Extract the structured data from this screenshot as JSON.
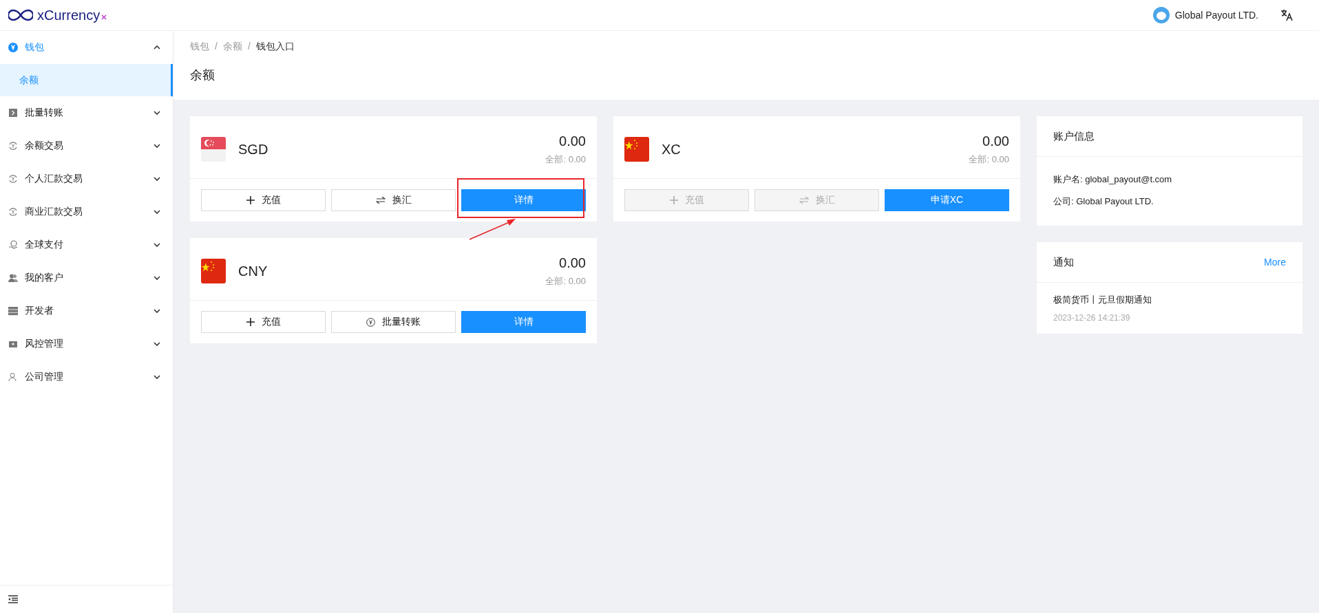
{
  "header": {
    "logo": "xCurrency",
    "account": "Global Payout LTD."
  },
  "sidebar": {
    "items": [
      {
        "label": "钱包",
        "expanded": true,
        "children": [
          {
            "label": "余额",
            "selected": true
          }
        ]
      },
      {
        "label": "批量转账",
        "expanded": false
      },
      {
        "label": "余额交易",
        "expanded": false
      },
      {
        "label": "个人汇款交易",
        "expanded": false
      },
      {
        "label": "商业汇款交易",
        "expanded": false
      },
      {
        "label": "全球支付",
        "expanded": false
      },
      {
        "label": "我的客户",
        "expanded": false
      },
      {
        "label": "开发者",
        "expanded": false
      },
      {
        "label": "风控管理",
        "expanded": false
      },
      {
        "label": "公司管理",
        "expanded": false
      }
    ]
  },
  "breadcrumb": {
    "separator": "/",
    "items": [
      "钱包",
      "余额",
      "钱包入口"
    ]
  },
  "page_title": "余额",
  "wallets": [
    {
      "currency": "SGD",
      "amount": "0.00",
      "total": "全部: 0.00",
      "buttons": [
        {
          "label": "充值",
          "kind": "add",
          "disabled": false,
          "highlighted": false
        },
        {
          "label": "换汇",
          "kind": "exchange",
          "disabled": false,
          "highlighted": false
        },
        {
          "label": "详情",
          "kind": "primary",
          "disabled": false,
          "highlighted": true
        }
      ]
    },
    {
      "currency": "CNY",
      "amount": "0.00",
      "total": "全部: 0.00",
      "buttons": [
        {
          "label": "充值",
          "kind": "add",
          "disabled": false,
          "highlighted": false
        },
        {
          "label": "批量转账",
          "kind": "transfer",
          "disabled": false,
          "highlighted": false
        },
        {
          "label": "详情",
          "kind": "primary",
          "disabled": false,
          "highlighted": false
        }
      ]
    },
    {
      "currency": "XC",
      "amount": "0.00",
      "total": "全部: 0.00",
      "buttons": [
        {
          "label": "充值",
          "kind": "add",
          "disabled": true,
          "highlighted": false
        },
        {
          "label": "换汇",
          "kind": "exchange",
          "disabled": true,
          "highlighted": false
        },
        {
          "label": "申请XC",
          "kind": "primary",
          "disabled": false,
          "highlighted": false
        }
      ]
    }
  ],
  "account_info": {
    "title": "账户信息",
    "lines": [
      "账户名: global_payout@t.com",
      "公司: Global Payout LTD."
    ]
  },
  "notices": {
    "title": "通知",
    "more": "More",
    "items": [
      {
        "title": "极简货币丨元旦假期通知",
        "time": "2023-12-26 14:21:39"
      }
    ]
  }
}
